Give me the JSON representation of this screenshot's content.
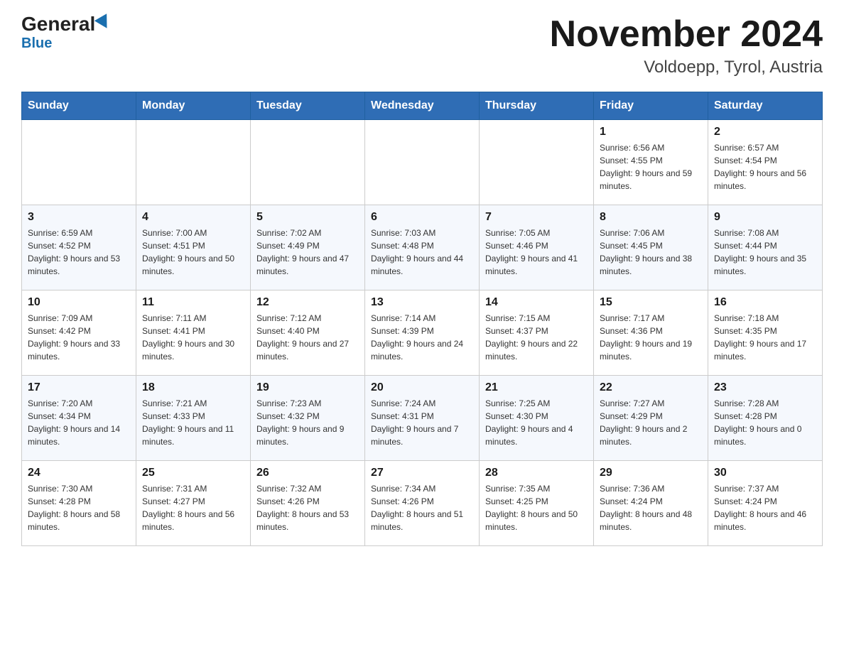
{
  "header": {
    "logo_main": "General",
    "logo_sub": "Blue",
    "title": "November 2024",
    "subtitle": "Voldoepp, Tyrol, Austria"
  },
  "days_of_week": [
    "Sunday",
    "Monday",
    "Tuesday",
    "Wednesday",
    "Thursday",
    "Friday",
    "Saturday"
  ],
  "weeks": [
    {
      "days": [
        {
          "number": "",
          "info": ""
        },
        {
          "number": "",
          "info": ""
        },
        {
          "number": "",
          "info": ""
        },
        {
          "number": "",
          "info": ""
        },
        {
          "number": "",
          "info": ""
        },
        {
          "number": "1",
          "info": "Sunrise: 6:56 AM\nSunset: 4:55 PM\nDaylight: 9 hours and 59 minutes."
        },
        {
          "number": "2",
          "info": "Sunrise: 6:57 AM\nSunset: 4:54 PM\nDaylight: 9 hours and 56 minutes."
        }
      ]
    },
    {
      "days": [
        {
          "number": "3",
          "info": "Sunrise: 6:59 AM\nSunset: 4:52 PM\nDaylight: 9 hours and 53 minutes."
        },
        {
          "number": "4",
          "info": "Sunrise: 7:00 AM\nSunset: 4:51 PM\nDaylight: 9 hours and 50 minutes."
        },
        {
          "number": "5",
          "info": "Sunrise: 7:02 AM\nSunset: 4:49 PM\nDaylight: 9 hours and 47 minutes."
        },
        {
          "number": "6",
          "info": "Sunrise: 7:03 AM\nSunset: 4:48 PM\nDaylight: 9 hours and 44 minutes."
        },
        {
          "number": "7",
          "info": "Sunrise: 7:05 AM\nSunset: 4:46 PM\nDaylight: 9 hours and 41 minutes."
        },
        {
          "number": "8",
          "info": "Sunrise: 7:06 AM\nSunset: 4:45 PM\nDaylight: 9 hours and 38 minutes."
        },
        {
          "number": "9",
          "info": "Sunrise: 7:08 AM\nSunset: 4:44 PM\nDaylight: 9 hours and 35 minutes."
        }
      ]
    },
    {
      "days": [
        {
          "number": "10",
          "info": "Sunrise: 7:09 AM\nSunset: 4:42 PM\nDaylight: 9 hours and 33 minutes."
        },
        {
          "number": "11",
          "info": "Sunrise: 7:11 AM\nSunset: 4:41 PM\nDaylight: 9 hours and 30 minutes."
        },
        {
          "number": "12",
          "info": "Sunrise: 7:12 AM\nSunset: 4:40 PM\nDaylight: 9 hours and 27 minutes."
        },
        {
          "number": "13",
          "info": "Sunrise: 7:14 AM\nSunset: 4:39 PM\nDaylight: 9 hours and 24 minutes."
        },
        {
          "number": "14",
          "info": "Sunrise: 7:15 AM\nSunset: 4:37 PM\nDaylight: 9 hours and 22 minutes."
        },
        {
          "number": "15",
          "info": "Sunrise: 7:17 AM\nSunset: 4:36 PM\nDaylight: 9 hours and 19 minutes."
        },
        {
          "number": "16",
          "info": "Sunrise: 7:18 AM\nSunset: 4:35 PM\nDaylight: 9 hours and 17 minutes."
        }
      ]
    },
    {
      "days": [
        {
          "number": "17",
          "info": "Sunrise: 7:20 AM\nSunset: 4:34 PM\nDaylight: 9 hours and 14 minutes."
        },
        {
          "number": "18",
          "info": "Sunrise: 7:21 AM\nSunset: 4:33 PM\nDaylight: 9 hours and 11 minutes."
        },
        {
          "number": "19",
          "info": "Sunrise: 7:23 AM\nSunset: 4:32 PM\nDaylight: 9 hours and 9 minutes."
        },
        {
          "number": "20",
          "info": "Sunrise: 7:24 AM\nSunset: 4:31 PM\nDaylight: 9 hours and 7 minutes."
        },
        {
          "number": "21",
          "info": "Sunrise: 7:25 AM\nSunset: 4:30 PM\nDaylight: 9 hours and 4 minutes."
        },
        {
          "number": "22",
          "info": "Sunrise: 7:27 AM\nSunset: 4:29 PM\nDaylight: 9 hours and 2 minutes."
        },
        {
          "number": "23",
          "info": "Sunrise: 7:28 AM\nSunset: 4:28 PM\nDaylight: 9 hours and 0 minutes."
        }
      ]
    },
    {
      "days": [
        {
          "number": "24",
          "info": "Sunrise: 7:30 AM\nSunset: 4:28 PM\nDaylight: 8 hours and 58 minutes."
        },
        {
          "number": "25",
          "info": "Sunrise: 7:31 AM\nSunset: 4:27 PM\nDaylight: 8 hours and 56 minutes."
        },
        {
          "number": "26",
          "info": "Sunrise: 7:32 AM\nSunset: 4:26 PM\nDaylight: 8 hours and 53 minutes."
        },
        {
          "number": "27",
          "info": "Sunrise: 7:34 AM\nSunset: 4:26 PM\nDaylight: 8 hours and 51 minutes."
        },
        {
          "number": "28",
          "info": "Sunrise: 7:35 AM\nSunset: 4:25 PM\nDaylight: 8 hours and 50 minutes."
        },
        {
          "number": "29",
          "info": "Sunrise: 7:36 AM\nSunset: 4:24 PM\nDaylight: 8 hours and 48 minutes."
        },
        {
          "number": "30",
          "info": "Sunrise: 7:37 AM\nSunset: 4:24 PM\nDaylight: 8 hours and 46 minutes."
        }
      ]
    }
  ]
}
